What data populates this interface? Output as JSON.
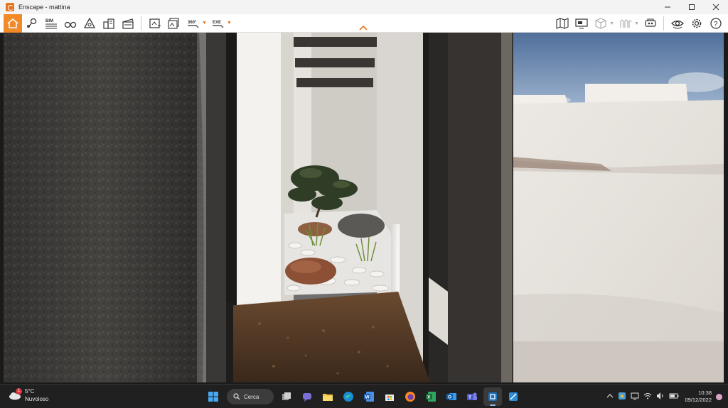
{
  "window": {
    "title": "Enscape - mattina",
    "controls": [
      "minimize-icon",
      "maximize-icon",
      "close-icon"
    ]
  },
  "toolbar": {
    "left_tools": [
      {
        "name": "home",
        "icon": "home-icon"
      },
      {
        "name": "location",
        "icon": "location-pin-icon"
      },
      {
        "name": "bim",
        "icon": "bim-icon",
        "label": "BIM"
      },
      {
        "name": "binoculars",
        "icon": "binoculars-icon"
      },
      {
        "name": "shape-measure",
        "icon": "triangle-icon"
      },
      {
        "name": "buildings",
        "icon": "buildings-icon"
      },
      {
        "name": "video",
        "icon": "clapperboard-icon"
      }
    ],
    "export_tools": [
      {
        "name": "screenshot",
        "icon": "screenshot-export-icon"
      },
      {
        "name": "batch-render",
        "icon": "batch-render-icon"
      },
      {
        "name": "panorama",
        "icon": "panorama-360-icon",
        "label": "360°"
      },
      {
        "name": "exe",
        "icon": "exe-export-icon",
        "label": "EXE"
      }
    ],
    "right_tools": [
      {
        "name": "map",
        "icon": "map-icon"
      },
      {
        "name": "monitor",
        "icon": "monitor-icon"
      },
      {
        "name": "cube",
        "icon": "cube-icon"
      },
      {
        "name": "materials",
        "icon": "materials-icon"
      },
      {
        "name": "vr",
        "icon": "vr-headset-icon"
      },
      {
        "name": "visual-settings",
        "icon": "eye-icon"
      },
      {
        "name": "settings",
        "icon": "gear-icon"
      },
      {
        "name": "help",
        "icon": "help-icon"
      }
    ]
  },
  "taskbar": {
    "weather": {
      "temp": "5°C",
      "condition": "Nuvoloso",
      "badge": "1"
    },
    "search_label": "Cerca",
    "apps": [
      "windows-start-icon",
      "search",
      "task-view-icon",
      "teams-chat-icon",
      "file-explorer-icon",
      "edge-icon",
      "word-icon",
      "store-icon",
      "firefox-icon",
      "excel-icon",
      "outlook-icon",
      "teams-icon",
      "sketchup-icon",
      "enscape-icon"
    ],
    "clock": {
      "time": "10:38",
      "date": "09/12/2022"
    }
  },
  "colors": {
    "accent": "#F28A2A",
    "titlebar": "#F3F3F3",
    "taskbar": "#202020"
  }
}
